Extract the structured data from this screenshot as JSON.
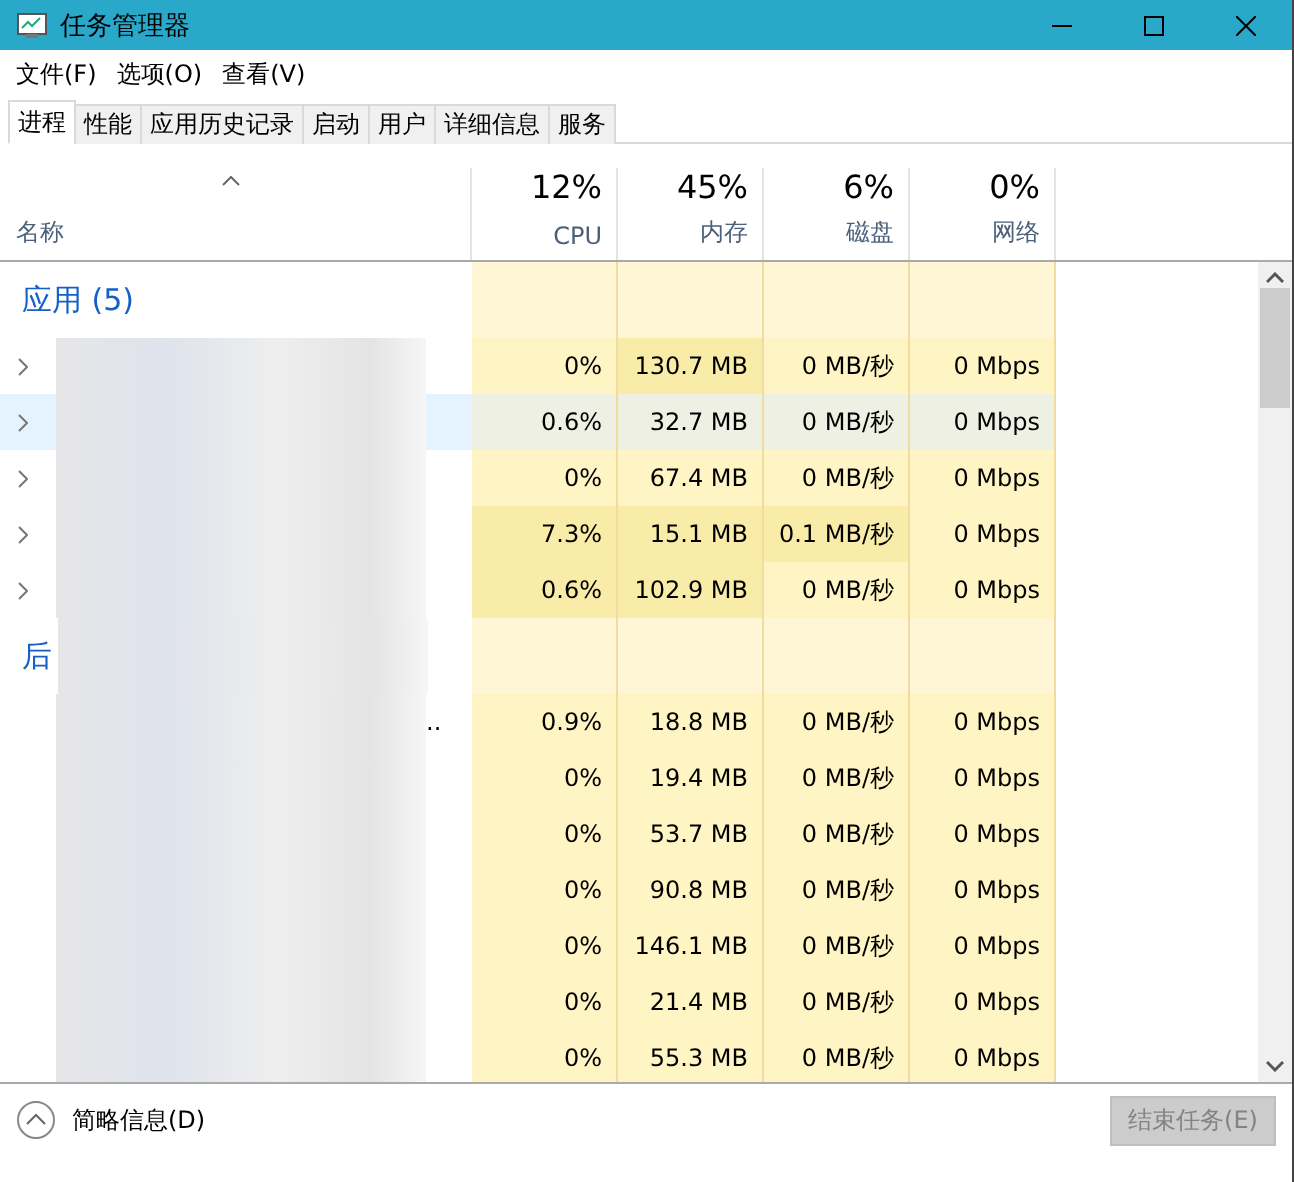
{
  "window": {
    "title": "任务管理器"
  },
  "menu": [
    "文件(F)",
    "选项(O)",
    "查看(V)"
  ],
  "tabs": [
    {
      "label": "进程",
      "selected": true
    },
    {
      "label": "性能",
      "selected": false
    },
    {
      "label": "应用历史记录",
      "selected": false
    },
    {
      "label": "启动",
      "selected": false
    },
    {
      "label": "用户",
      "selected": false
    },
    {
      "label": "详细信息",
      "selected": false
    },
    {
      "label": "服务",
      "selected": false
    }
  ],
  "name_column": {
    "label": "名称"
  },
  "columns": [
    {
      "percent": "12%",
      "label": "CPU"
    },
    {
      "percent": "45%",
      "label": "内存"
    },
    {
      "percent": "6%",
      "label": "磁盘"
    },
    {
      "percent": "0%",
      "label": "网络"
    }
  ],
  "groups": [
    {
      "title": "应用 (5)",
      "rows": [
        {
          "expandable": true,
          "selected": false,
          "cells": [
            {
              "text": "0%",
              "color": "#fff4c4"
            },
            {
              "text": "130.7 MB",
              "color": "#f9eba8"
            },
            {
              "text": "0 MB/秒",
              "color": "#fff4c4"
            },
            {
              "text": "0 Mbps",
              "color": "#fff4c4"
            }
          ]
        },
        {
          "expandable": true,
          "selected": true,
          "cells": [
            {
              "text": "0.6%",
              "color": "#eef0e4"
            },
            {
              "text": "32.7 MB",
              "color": "#eef0e4"
            },
            {
              "text": "0 MB/秒",
              "color": "#eef0e4"
            },
            {
              "text": "0 Mbps",
              "color": "#eef0e4"
            }
          ]
        },
        {
          "expandable": true,
          "selected": false,
          "cells": [
            {
              "text": "0%",
              "color": "#fff4c4"
            },
            {
              "text": "67.4 MB",
              "color": "#fff4c4"
            },
            {
              "text": "0 MB/秒",
              "color": "#fff4c4"
            },
            {
              "text": "0 Mbps",
              "color": "#fff4c4"
            }
          ]
        },
        {
          "expandable": true,
          "selected": false,
          "cells": [
            {
              "text": "7.3%",
              "color": "#f9eba8"
            },
            {
              "text": "15.1 MB",
              "color": "#f9eba8"
            },
            {
              "text": "0.1 MB/秒",
              "color": "#f9eba8"
            },
            {
              "text": "0 Mbps",
              "color": "#fff4c4"
            }
          ]
        },
        {
          "expandable": true,
          "selected": false,
          "cells": [
            {
              "text": "0.6%",
              "color": "#f9eba8"
            },
            {
              "text": "102.9 MB",
              "color": "#f9eba8"
            },
            {
              "text": "0 MB/秒",
              "color": "#fff4c4"
            },
            {
              "text": "0 Mbps",
              "color": "#fff4c4"
            }
          ]
        }
      ]
    },
    {
      "title": "后",
      "rows": [
        {
          "expandable": false,
          "selected": false,
          "name": "..",
          "cells": [
            {
              "text": "0.9%",
              "color": "#fff4c4"
            },
            {
              "text": "18.8 MB",
              "color": "#fff4c4"
            },
            {
              "text": "0 MB/秒",
              "color": "#fff4c4"
            },
            {
              "text": "0 Mbps",
              "color": "#fff4c4"
            }
          ]
        },
        {
          "expandable": false,
          "selected": false,
          "cells": [
            {
              "text": "0%",
              "color": "#fff4c4"
            },
            {
              "text": "19.4 MB",
              "color": "#fff4c4"
            },
            {
              "text": "0 MB/秒",
              "color": "#fff4c4"
            },
            {
              "text": "0 Mbps",
              "color": "#fff4c4"
            }
          ]
        },
        {
          "expandable": false,
          "selected": false,
          "cells": [
            {
              "text": "0%",
              "color": "#fff4c4"
            },
            {
              "text": "53.7 MB",
              "color": "#fff4c4"
            },
            {
              "text": "0 MB/秒",
              "color": "#fff4c4"
            },
            {
              "text": "0 Mbps",
              "color": "#fff4c4"
            }
          ]
        },
        {
          "expandable": false,
          "selected": false,
          "cells": [
            {
              "text": "0%",
              "color": "#fff4c4"
            },
            {
              "text": "90.8 MB",
              "color": "#fff4c4"
            },
            {
              "text": "0 MB/秒",
              "color": "#fff4c4"
            },
            {
              "text": "0 Mbps",
              "color": "#fff4c4"
            }
          ]
        },
        {
          "expandable": false,
          "selected": false,
          "cells": [
            {
              "text": "0%",
              "color": "#fff4c4"
            },
            {
              "text": "146.1 MB",
              "color": "#fff4c4"
            },
            {
              "text": "0 MB/秒",
              "color": "#fff4c4"
            },
            {
              "text": "0 Mbps",
              "color": "#fff4c4"
            }
          ]
        },
        {
          "expandable": false,
          "selected": false,
          "cells": [
            {
              "text": "0%",
              "color": "#fff4c4"
            },
            {
              "text": "21.4 MB",
              "color": "#fff4c4"
            },
            {
              "text": "0 MB/秒",
              "color": "#fff4c4"
            },
            {
              "text": "0 Mbps",
              "color": "#fff4c4"
            }
          ]
        },
        {
          "expandable": false,
          "selected": false,
          "cells": [
            {
              "text": "0%",
              "color": "#fff4c4"
            },
            {
              "text": "55.3 MB",
              "color": "#fff4c4"
            },
            {
              "text": "0 MB/秒",
              "color": "#fff4c4"
            },
            {
              "text": "0 Mbps",
              "color": "#fff4c4"
            }
          ]
        }
      ]
    }
  ],
  "footer": {
    "details": "简略信息(D)",
    "end_task": {
      "label": "结束任务(E)",
      "disabled": true
    }
  }
}
